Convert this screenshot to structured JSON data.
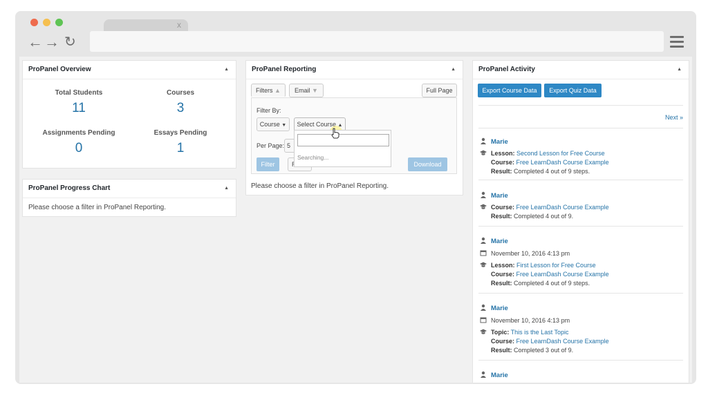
{
  "browser": {
    "tab_close": "x",
    "traffic_colors": [
      "#ee6b4d",
      "#f5bf4f",
      "#5fc454"
    ]
  },
  "overview": {
    "title": "ProPanel Overview",
    "stats": [
      {
        "label": "Total Students",
        "value": "11"
      },
      {
        "label": "Courses",
        "value": "3"
      },
      {
        "label": "Assignments Pending",
        "value": "0"
      },
      {
        "label": "Essays Pending",
        "value": "1"
      }
    ]
  },
  "progress_chart": {
    "title": "ProPanel Progress Chart",
    "message": "Please choose a filter in ProPanel Reporting."
  },
  "reporting": {
    "title": "ProPanel Reporting",
    "tab_filters": "Filters",
    "tab_email": "Email",
    "full_page": "Full Page",
    "filter_by": "Filter By:",
    "type_select": "Course",
    "course_select": "Select Course",
    "per_page_label": "Per Page:",
    "per_page_value": "5",
    "reset_partial": "R",
    "filter_button": "Filter",
    "download_button": "Download",
    "search_placeholder": "",
    "searching": "Searching...",
    "message": "Please choose a filter in ProPanel Reporting."
  },
  "activity": {
    "title": "ProPanel Activity",
    "export_course": "Export Course Data",
    "export_quiz": "Export Quiz Data",
    "next": "Next »",
    "labels": {
      "lesson": "Lesson:",
      "course": "Course:",
      "result": "Result:",
      "topic": "Topic:"
    },
    "entries": [
      {
        "user": "Marie",
        "lesson": "Second Lesson for Free Course",
        "course": "Free LearnDash Course Example",
        "result": "Completed 4 out of 9 steps."
      },
      {
        "user": "Marie",
        "course": "Free LearnDash Course Example",
        "result": "Completed 4 out of 9."
      },
      {
        "user": "Marie",
        "date": "November 10, 2016 4:13 pm",
        "lesson": "First Lesson for Free Course",
        "course": "Free LearnDash Course Example",
        "result": "Completed 4 out of 9 steps."
      },
      {
        "user": "Marie",
        "date": "November 10, 2016 4:13 pm",
        "topic": "This is the Last Topic",
        "course": "Free LearnDash Course Example",
        "result": "Completed 3 out of 9."
      },
      {
        "user": "Marie"
      }
    ]
  }
}
